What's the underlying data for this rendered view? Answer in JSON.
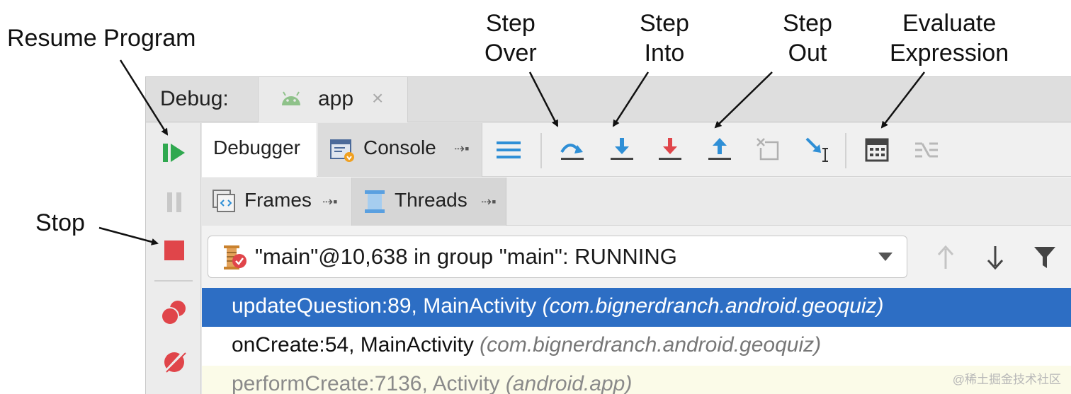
{
  "annotations": {
    "resume_program": "Resume Program",
    "stop": "Stop",
    "step_over": [
      "Step",
      "Over"
    ],
    "step_into": [
      "Step",
      "Into"
    ],
    "step_out": [
      "Step",
      "Out"
    ],
    "evaluate_expression": [
      "Evaluate",
      "Expression"
    ]
  },
  "titlebar": {
    "debug_label": "Debug:",
    "tab_label": "app",
    "close_glyph": "×"
  },
  "tabs": {
    "debugger": "Debugger",
    "console": "Console"
  },
  "subtabs": {
    "frames": "Frames",
    "threads": "Threads"
  },
  "thread_selector": {
    "value": "\"main\"@10,638 in group \"main\": RUNNING"
  },
  "frames": [
    {
      "method": "updateQuestion:89, MainActivity",
      "package": "(com.bignerdranch.android.geoquiz)",
      "state": "selected"
    },
    {
      "method": "onCreate:54, MainActivity",
      "package": "(com.bignerdranch.android.geoquiz)",
      "state": "normal"
    },
    {
      "method": "performCreate:7136, Activity",
      "package": "(android.app)",
      "state": "library"
    }
  ],
  "colors": {
    "resume_green": "#2fa84f",
    "stop_red": "#e0454a",
    "step_blue": "#2f8fd6",
    "selection_blue": "#2d6ec4"
  },
  "watermark": "@稀土掘金技术社区"
}
